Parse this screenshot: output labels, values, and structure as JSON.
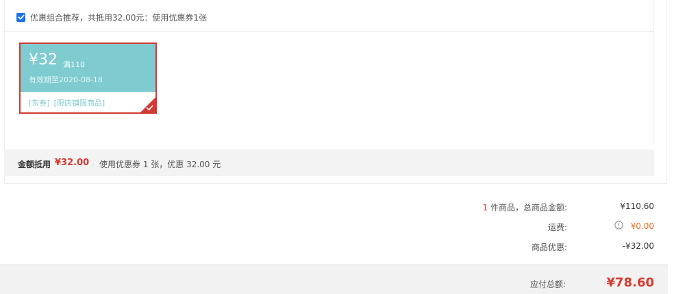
{
  "combo": {
    "checked": true,
    "text": "优惠组合推荐，共抵用32.00元：使用优惠券1张"
  },
  "coupon": {
    "amount": "¥32",
    "condition": "满110",
    "valid_until": "有效期至2020-08-18",
    "tags": [
      "[东券]",
      "[限店铺限商品]"
    ],
    "selected": true,
    "colors": {
      "accent": "#7ecbd0",
      "border": "#d33a31"
    }
  },
  "summary": {
    "label": "金额抵用",
    "amount": "¥32.00",
    "description": "使用优惠券 1 张，优惠 32.00 元"
  },
  "totals": {
    "items_count": "1",
    "items_label": " 件商品，总商品金额:",
    "items_value": "¥110.60",
    "shipping_label": "运费:",
    "shipping_value": "¥0.00",
    "discount_label": "商品优惠:",
    "discount_value": "-¥32.00",
    "payable_label": "应付总额:",
    "payable_value": "¥78.60"
  },
  "icons": {
    "checkbox": "check-icon",
    "corner": "checkmark-corner-icon",
    "info": "info-circle-icon"
  },
  "colors": {
    "price_red": "#d33a31",
    "shipping_orange": "#e86a1f",
    "checkbox_blue": "#1a73e8"
  }
}
